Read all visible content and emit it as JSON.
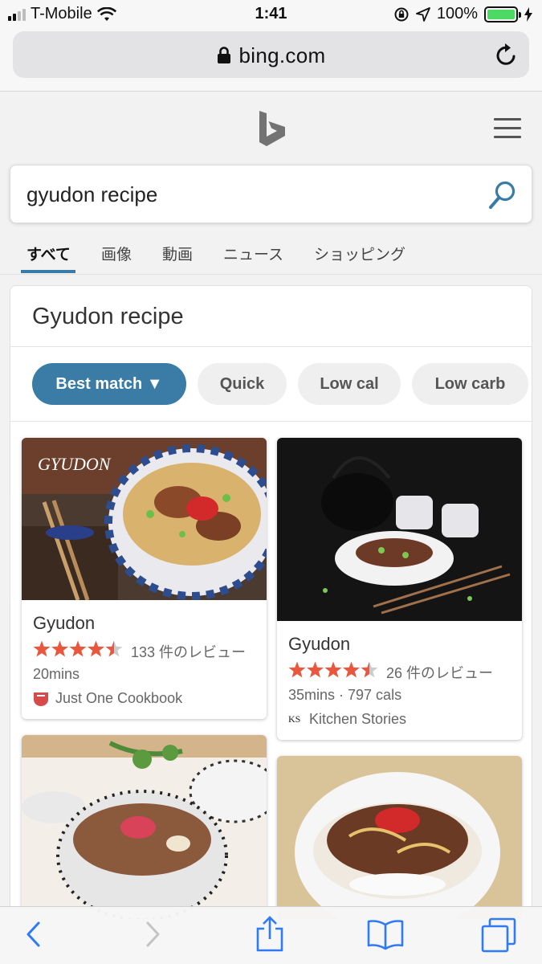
{
  "status_bar": {
    "carrier": "T-Mobile",
    "time": "1:41",
    "battery": "100%",
    "signal_bars": 2
  },
  "browser": {
    "url": "bing.com"
  },
  "search": {
    "query": "gyudon recipe"
  },
  "tabs": [
    {
      "label": "すべて",
      "active": true
    },
    {
      "label": "画像"
    },
    {
      "label": "動画"
    },
    {
      "label": "ニュース"
    },
    {
      "label": "ショッピング"
    }
  ],
  "card": {
    "title": "Gyudon recipe",
    "filters": [
      {
        "label": "Best match ▼",
        "active": true
      },
      {
        "label": "Quick"
      },
      {
        "label": "Low cal"
      },
      {
        "label": "Low carb"
      }
    ]
  },
  "recipes": [
    {
      "photo_overlay_text": "GYUDON",
      "name": "Gyudon",
      "rating": 4.5,
      "reviews": "133 件のレビュー",
      "meta": "20mins",
      "source": "Just One Cookbook"
    },
    {
      "name": "Gyudon",
      "rating": 4.5,
      "reviews": "26 件のレビュー",
      "meta": "35mins · 797 cals",
      "source": "Kitchen Stories",
      "source_logo_text": "KS"
    },
    {},
    {}
  ],
  "colors": {
    "accent": "#3a7ca5",
    "star": "#e8573e",
    "star_empty": "#cccccc"
  }
}
